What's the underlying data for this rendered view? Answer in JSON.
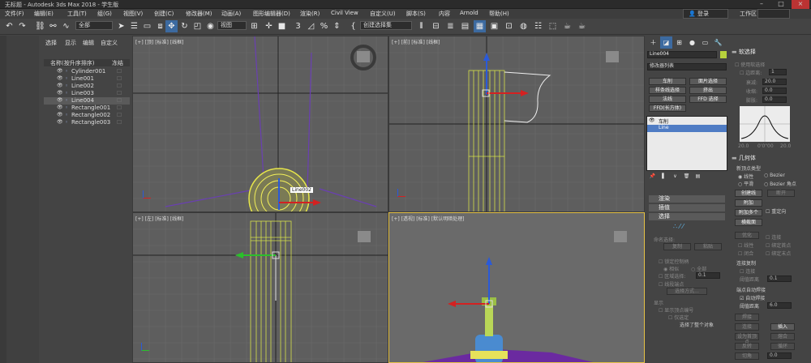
{
  "window": {
    "title": "无标题 - Autodesk 3ds Max 2018 - 学生版"
  },
  "menu": {
    "items": [
      "文件(F)",
      "编辑(E)",
      "工具(T)",
      "组(G)",
      "视图(V)",
      "创建(C)",
      "修改器(M)",
      "动画(A)",
      "图形编辑器(D)",
      "渲染(R)",
      "Civil View",
      "自定义(U)",
      "脚本(S)",
      "内容",
      "Arnold",
      "帮助(H)"
    ],
    "login": "登录",
    "workspace_label": "工作区"
  },
  "toolbar": {
    "filter_value": "全部",
    "view_value": "视图",
    "selection_set": "创建选择集"
  },
  "explorer": {
    "tabs": [
      "选择",
      "显示",
      "编辑",
      "自定义"
    ],
    "col_name": "名称(按升序排序)",
    "col_frozen": "冻结",
    "objects": [
      {
        "name": "Cylinder001",
        "selected": false
      },
      {
        "name": "Line001",
        "selected": false
      },
      {
        "name": "Line002",
        "selected": false
      },
      {
        "name": "Line003",
        "selected": false
      },
      {
        "name": "Line004",
        "selected": true
      },
      {
        "name": "Rectangle001",
        "selected": false
      },
      {
        "name": "Rectangle002",
        "selected": false
      },
      {
        "name": "Rectangle003",
        "selected": false
      }
    ]
  },
  "viewports": {
    "top": {
      "label": "[+] [顶] [标准] [线框]",
      "tag": "Line002"
    },
    "front": {
      "label": "[+] [前] [标准] [线框]"
    },
    "left": {
      "label": "[+] [左] [标准] [线框]"
    },
    "persp": {
      "label": "[+] [透视] [标准] [默认明暗处理]"
    }
  },
  "command_panel": {
    "object_name": "Line004",
    "object_color": "#b7d23c",
    "modifier_list": "修改器列表",
    "buttons": [
      "车削",
      "面片选择",
      "样条线选择",
      "挤出",
      "法线",
      "FFD 选择",
      "FFD(长方体)"
    ],
    "stack": [
      {
        "label": "车削",
        "expanded": true
      },
      {
        "label": "Line",
        "selected": true
      }
    ],
    "rollouts": [
      "渲染",
      "插值",
      "选择"
    ],
    "selection": {
      "named_sel": "命名选择:",
      "copy": "复制",
      "paste": "粘贴",
      "lock": "锁定控制柄",
      "similar": "相似",
      "all": "全部",
      "area_sel": "区域选择:",
      "area_val": "0.1",
      "segment_end": "线段端点",
      "select_by": "选择方式...",
      "display": "显示",
      "show_vertex": "显示顶点编号",
      "only_sel": "仅选定",
      "status": "选择了整个对象"
    }
  },
  "soft_selection": {
    "title": "软选择",
    "use_soft": "使用软选择",
    "edge_dist": "边距离:",
    "edge_val": "1",
    "falloff": "衰减:",
    "falloff_val": "20.0",
    "pinch": "收缩:",
    "pinch_val": "0.0",
    "bubble": "膨胀:",
    "bubble_val": "0.0",
    "curve_left": "20.0",
    "curve_mid": "0'0\"00",
    "curve_right": "20.0"
  },
  "geometry": {
    "title": "几何体",
    "new_vertex_type": "新顶点类型",
    "linear": "线性",
    "bezier": "Bezier",
    "smooth": "平滑",
    "bezier_corner": "Bezier 角点",
    "create_line": "创建线",
    "break": "断开",
    "attach": "附加",
    "attach_mult": "附加多个",
    "reorient": "重定向",
    "cross_section": "横截面",
    "optimize": "优化",
    "connect": "连接",
    "linear2": "线性",
    "bind_first": "绑定首点",
    "closed": "闭合",
    "bind_last": "绑定末点",
    "connect_copy": "连接复制",
    "connect_cb": "连接",
    "threshold": "阈值距离",
    "threshold_val": "0.1",
    "auto_weld_title": "端点自动焊接",
    "auto_weld": "自动焊接",
    "weld_thresh": "阈值距离",
    "weld_val": "6.0",
    "weld": "焊接",
    "connect2": "连接",
    "insert": "插入",
    "set_first": "设为首顶点",
    "fuse": "熔合",
    "reverse": "反转",
    "circle": "循环",
    "fillet": "圆角",
    "chamfer": "切角",
    "fillet_val": "0.0"
  }
}
